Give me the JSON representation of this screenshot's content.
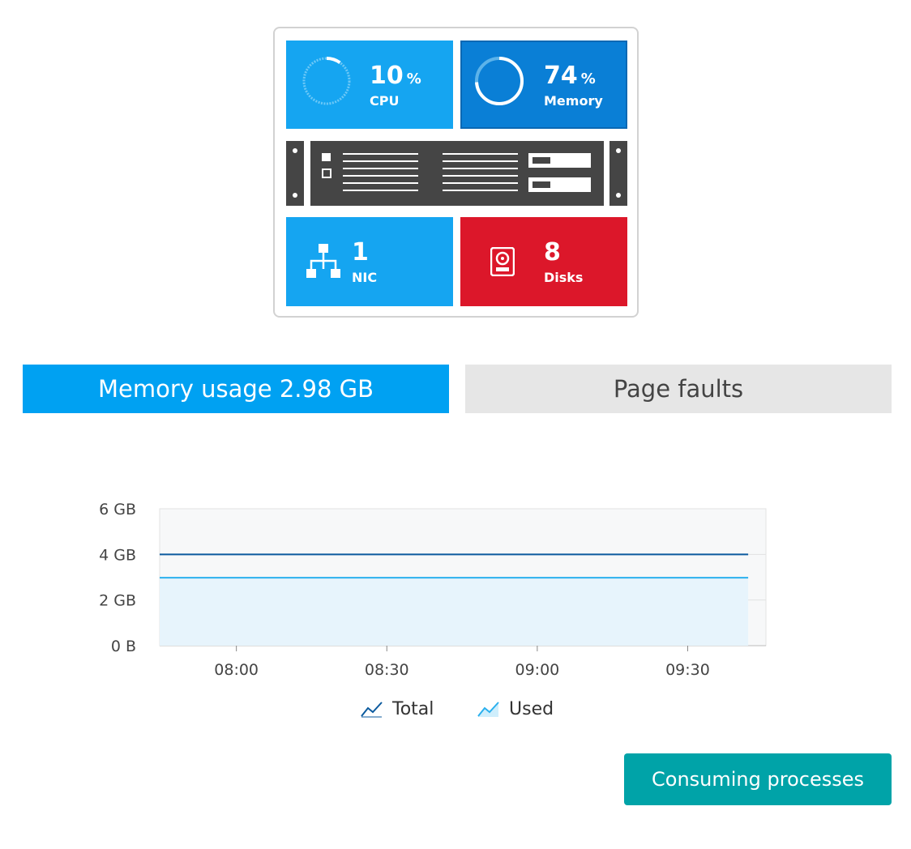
{
  "host": {
    "cpu": {
      "value": "10",
      "unit": "%",
      "label": "CPU"
    },
    "memory": {
      "value": "74",
      "unit": "%",
      "label": "Memory"
    },
    "nic": {
      "value": "1",
      "label": "NIC"
    },
    "disks": {
      "value": "8",
      "label": "Disks"
    }
  },
  "colors": {
    "cpu_tile": "#15a5f1",
    "memory_tile": "#0a7fd6",
    "nic_tile": "#15a5f1",
    "disks_tile": "#dc172a",
    "active_tab": "#00a1f2",
    "button": "#00a3a8",
    "total_line": "#0b5a9e",
    "used_line": "#2ab0ee"
  },
  "tabs": [
    {
      "label": "Memory usage 2.98 GB",
      "active": true
    },
    {
      "label": "Page faults",
      "active": false
    }
  ],
  "chart_data": {
    "type": "area",
    "x": [
      "07:46",
      "08:00",
      "08:30",
      "09:00",
      "09:30",
      "09:44"
    ],
    "series": [
      {
        "name": "Total",
        "values": [
          4.0,
          4.0,
          4.0,
          4.0,
          4.0,
          4.0
        ]
      },
      {
        "name": "Used",
        "values": [
          2.98,
          2.98,
          2.98,
          2.98,
          2.98,
          2.98
        ]
      }
    ],
    "xticks": [
      "08:00",
      "08:30",
      "09:00",
      "09:30"
    ],
    "yticks": [
      "0 B",
      "2 GB",
      "4 GB",
      "6 GB"
    ],
    "ylim": [
      0,
      6
    ],
    "xlabel": "",
    "ylabel": "",
    "grid": true,
    "legend_position": "bottom"
  },
  "legend": {
    "total": "Total",
    "used": "Used"
  },
  "button": {
    "label": "Consuming processes"
  }
}
